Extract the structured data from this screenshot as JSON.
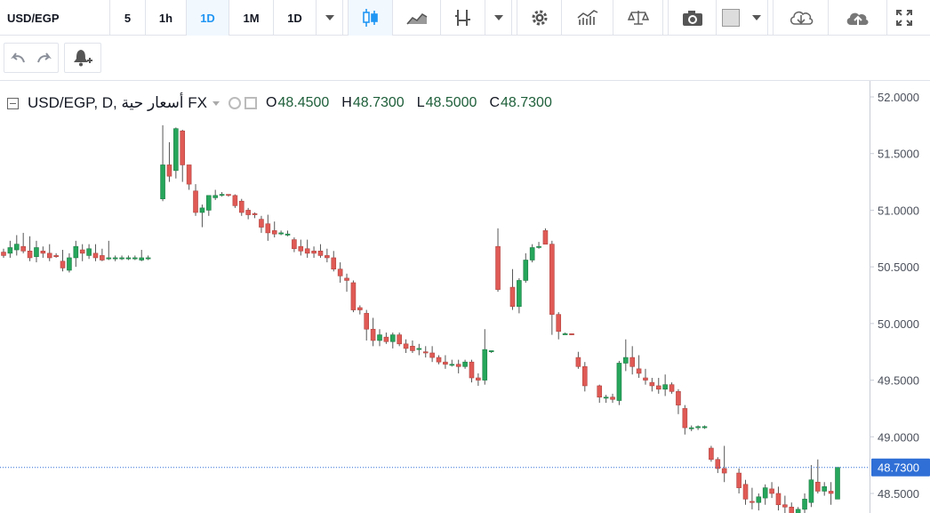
{
  "toolbar": {
    "symbol": "USD/EGP",
    "intervals": [
      "5",
      "1h",
      "1D",
      "1M"
    ],
    "active_interval": "1D",
    "interval_dropdown": "1D",
    "icons": [
      "candles-icon",
      "area-chart-icon",
      "indicators-icon",
      "settings-icon",
      "compare-icon",
      "balance-icon",
      "camera-icon",
      "color-square-icon",
      "cloud-download-icon",
      "cloud-upload-icon",
      "fullscreen-icon"
    ]
  },
  "toolbar2": {
    "icons": [
      "undo-icon",
      "redo-icon",
      "add-alert-icon"
    ]
  },
  "legend": {
    "title": "USD/EGP, D, أسعار حية FX",
    "open_label": "O",
    "open": "48.4500",
    "high_label": "H",
    "high": "48.7300",
    "low_label": "L",
    "low": "48.5000",
    "close_label": "C",
    "close": "48.7300"
  },
  "colors": {
    "up": "#26a65b",
    "down": "#e05a55",
    "wick": "#555555",
    "price_line": "#2f6fd6",
    "price_label_bg": "#2f6fd6"
  },
  "chart_data": {
    "type": "candlestick",
    "ylim": [
      48.3,
      52.15
    ],
    "yticks": [
      "52.0000",
      "51.5000",
      "51.0000",
      "50.5000",
      "50.0000",
      "49.5000",
      "49.0000",
      "48.5000"
    ],
    "last_price": "48.7300",
    "candles": [
      [
        50.63,
        50.66,
        50.58,
        50.6
      ],
      [
        50.62,
        50.73,
        50.58,
        50.67
      ],
      [
        50.65,
        50.78,
        50.6,
        50.7
      ],
      [
        50.68,
        50.8,
        50.62,
        50.64
      ],
      [
        50.64,
        50.77,
        50.55,
        50.58
      ],
      [
        50.59,
        50.73,
        50.54,
        50.67
      ],
      [
        50.64,
        50.68,
        50.58,
        50.62
      ],
      [
        50.62,
        50.7,
        50.55,
        50.58
      ],
      [
        50.6,
        50.62,
        50.58,
        50.59
      ],
      [
        50.55,
        50.65,
        50.46,
        50.49
      ],
      [
        50.47,
        50.62,
        50.45,
        50.58
      ],
      [
        50.58,
        50.73,
        50.5,
        50.68
      ],
      [
        50.65,
        50.7,
        50.55,
        50.62
      ],
      [
        50.6,
        50.7,
        50.57,
        50.66
      ],
      [
        50.62,
        50.7,
        50.55,
        50.58
      ],
      [
        50.6,
        50.66,
        50.55,
        50.56
      ],
      [
        50.57,
        50.73,
        50.56,
        50.58
      ],
      [
        50.58,
        50.6,
        50.55,
        50.58
      ],
      [
        50.58,
        50.6,
        50.56,
        50.58
      ],
      [
        50.58,
        50.6,
        50.56,
        50.58
      ],
      [
        50.58,
        50.6,
        50.56,
        50.58
      ],
      [
        50.56,
        50.65,
        50.55,
        50.58
      ],
      [
        50.58,
        50.6,
        50.56,
        50.58
      ],
      [
        51.1,
        51.75,
        51.08,
        51.4
      ],
      [
        51.4,
        51.6,
        51.25,
        51.3
      ],
      [
        51.35,
        51.73,
        51.28,
        51.72
      ],
      [
        51.7,
        51.71,
        51.25,
        51.4
      ],
      [
        51.4,
        51.4,
        51.18,
        51.23
      ],
      [
        51.17,
        51.23,
        50.95,
        50.98
      ],
      [
        50.98,
        51.05,
        50.85,
        51.02
      ],
      [
        51.0,
        51.12,
        50.95,
        51.13
      ],
      [
        51.11,
        51.18,
        51.09,
        51.13
      ],
      [
        51.14,
        51.16,
        51.12,
        51.14
      ],
      [
        51.14,
        51.14,
        51.12,
        51.13
      ],
      [
        51.13,
        51.14,
        51.02,
        51.04
      ],
      [
        51.08,
        51.1,
        50.95,
        50.98
      ],
      [
        51.0,
        51.02,
        50.92,
        50.96
      ],
      [
        50.97,
        50.98,
        50.93,
        50.96
      ],
      [
        50.92,
        50.95,
        50.8,
        50.85
      ],
      [
        50.88,
        50.96,
        50.73,
        50.8
      ],
      [
        50.82,
        50.9,
        50.76,
        50.79
      ],
      [
        50.8,
        50.82,
        50.78,
        50.8
      ],
      [
        50.78,
        50.82,
        50.77,
        50.79
      ],
      [
        50.74,
        50.76,
        50.63,
        50.66
      ],
      [
        50.68,
        50.74,
        50.6,
        50.64
      ],
      [
        50.66,
        50.74,
        50.58,
        50.62
      ],
      [
        50.64,
        50.68,
        50.58,
        50.62
      ],
      [
        50.64,
        50.7,
        50.58,
        50.6
      ],
      [
        50.6,
        50.66,
        50.54,
        50.58
      ],
      [
        50.58,
        50.64,
        50.46,
        50.48
      ],
      [
        50.48,
        50.54,
        50.36,
        50.42
      ],
      [
        50.4,
        50.44,
        50.28,
        50.38
      ],
      [
        50.36,
        50.38,
        50.1,
        50.12
      ],
      [
        50.14,
        50.16,
        50.08,
        50.12
      ],
      [
        50.09,
        50.12,
        49.85,
        49.95
      ],
      [
        49.95,
        50.05,
        49.8,
        49.85
      ],
      [
        49.85,
        49.95,
        49.8,
        49.9
      ],
      [
        49.88,
        49.92,
        49.82,
        49.84
      ],
      [
        49.84,
        49.92,
        49.78,
        49.9
      ],
      [
        49.9,
        49.92,
        49.8,
        49.82
      ],
      [
        49.82,
        49.86,
        49.74,
        49.78
      ],
      [
        49.8,
        49.85,
        49.74,
        49.76
      ],
      [
        49.77,
        49.82,
        49.72,
        49.78
      ],
      [
        49.75,
        49.8,
        49.7,
        49.74
      ],
      [
        49.74,
        49.8,
        49.66,
        49.7
      ],
      [
        49.7,
        49.72,
        49.64,
        49.66
      ],
      [
        49.66,
        49.72,
        49.6,
        49.64
      ],
      [
        49.64,
        49.68,
        49.62,
        49.64
      ],
      [
        49.64,
        49.68,
        49.56,
        49.62
      ],
      [
        49.62,
        49.68,
        49.6,
        49.66
      ],
      [
        49.66,
        49.68,
        49.48,
        49.52
      ],
      [
        49.52,
        49.56,
        49.45,
        49.5
      ],
      [
        49.5,
        49.95,
        49.46,
        49.77
      ],
      [
        49.76,
        49.76,
        49.74,
        49.76
      ],
      [
        50.68,
        50.84,
        50.28,
        50.3
      ],
      [
        50.32,
        50.48,
        50.12,
        50.15
      ],
      [
        50.15,
        50.4,
        50.09,
        50.38
      ],
      [
        50.38,
        50.62,
        50.36,
        50.56
      ],
      [
        50.56,
        50.7,
        50.54,
        50.67
      ],
      [
        50.68,
        50.72,
        50.66,
        50.68
      ],
      [
        50.82,
        50.84,
        50.7,
        50.7
      ],
      [
        50.7,
        50.73,
        49.9,
        50.08
      ],
      [
        50.08,
        50.1,
        49.86,
        49.93
      ],
      [
        49.91,
        49.92,
        49.9,
        49.91
      ],
      [
        49.91,
        49.91,
        49.9,
        49.9
      ],
      [
        49.7,
        49.75,
        49.6,
        49.62
      ],
      [
        49.62,
        49.66,
        49.4,
        49.45
      ],
      [
        49.45,
        49.46,
        49.3,
        49.35
      ],
      [
        49.35,
        49.37,
        49.3,
        49.35
      ],
      [
        49.35,
        49.38,
        49.3,
        49.33
      ],
      [
        49.32,
        49.67,
        49.28,
        49.65
      ],
      [
        49.65,
        49.86,
        49.58,
        49.7
      ],
      [
        49.7,
        49.8,
        49.55,
        49.62
      ],
      [
        49.6,
        49.72,
        49.52,
        49.56
      ],
      [
        49.52,
        49.6,
        49.46,
        49.5
      ],
      [
        49.48,
        49.52,
        49.4,
        49.45
      ],
      [
        49.45,
        49.52,
        49.38,
        49.42
      ],
      [
        49.42,
        49.55,
        49.36,
        49.46
      ],
      [
        49.46,
        49.48,
        49.38,
        49.4
      ],
      [
        49.4,
        49.42,
        49.2,
        49.28
      ],
      [
        49.25,
        49.28,
        49.02,
        49.08
      ],
      [
        49.08,
        49.1,
        49.05,
        49.08
      ],
      [
        49.08,
        49.1,
        49.06,
        49.09
      ],
      [
        49.08,
        49.1,
        49.07,
        49.09
      ],
      [
        48.9,
        48.92,
        48.78,
        48.8
      ],
      [
        48.8,
        48.82,
        48.68,
        48.72
      ],
      [
        48.72,
        48.92,
        48.6,
        48.68
      ],
      [
        48.68,
        48.72,
        48.5,
        48.55
      ],
      [
        48.58,
        48.62,
        48.4,
        48.45
      ],
      [
        48.43,
        48.55,
        48.36,
        48.42
      ],
      [
        48.42,
        48.5,
        48.35,
        48.47
      ],
      [
        48.46,
        48.58,
        48.4,
        48.55
      ],
      [
        48.54,
        48.6,
        48.46,
        48.5
      ],
      [
        48.5,
        48.56,
        48.35,
        48.4
      ],
      [
        48.4,
        48.48,
        48.32,
        48.38
      ],
      [
        48.38,
        48.42,
        48.28,
        48.3
      ],
      [
        48.3,
        48.38,
        48.25,
        48.36
      ],
      [
        48.36,
        48.5,
        48.3,
        48.45
      ],
      [
        48.42,
        48.75,
        48.38,
        48.62
      ],
      [
        48.6,
        48.8,
        48.5,
        48.52
      ],
      [
        48.52,
        48.6,
        48.48,
        48.56
      ],
      [
        48.52,
        48.6,
        48.4,
        48.5
      ],
      [
        48.45,
        48.73,
        48.45,
        48.73
      ]
    ],
    "gaps_after": [
      22,
      74,
      86,
      106
    ]
  }
}
